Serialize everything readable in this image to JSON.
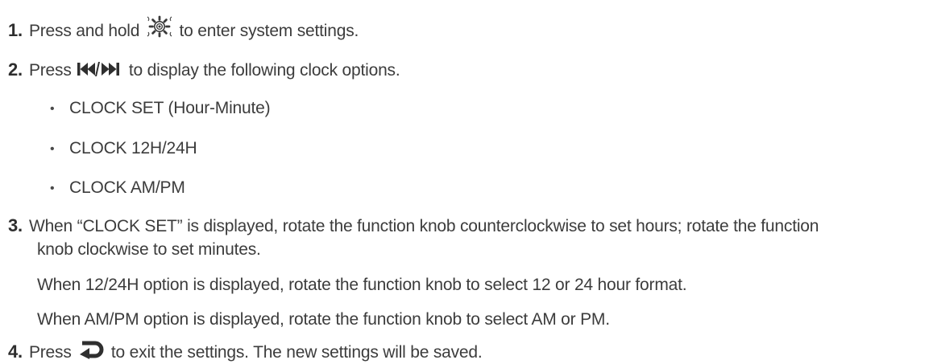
{
  "steps": [
    {
      "number": "1.",
      "text_before": "Press and hold",
      "icon": "gear-icon",
      "text_after": "to enter system settings."
    },
    {
      "number": "2.",
      "text_before": "Press",
      "icon": "skip-prev-next-icon",
      "text_after": "to display the following clock options.",
      "options": [
        "CLOCK SET (Hour-Minute)",
        "CLOCK 12H/24H",
        "CLOCK AM/PM"
      ]
    },
    {
      "number": "3.",
      "line1": "When “CLOCK SET” is displayed, rotate the function knob counterclockwise to set hours; rotate the function",
      "line2": "knob clockwise to set minutes.",
      "para2": "When 12/24H option is displayed, rotate the function knob to select 12 or 24 hour format.",
      "para3": "When AM/PM option is displayed, rotate the function knob to select AM or PM."
    },
    {
      "number": "4.",
      "text_before": "Press",
      "icon": "return-arrow-icon",
      "text_after": "to exit the settings. The new settings will be saved."
    }
  ],
  "bullet_char": "•",
  "colors": {
    "text": "#3c3c3c",
    "number": "#2e2e2e"
  }
}
